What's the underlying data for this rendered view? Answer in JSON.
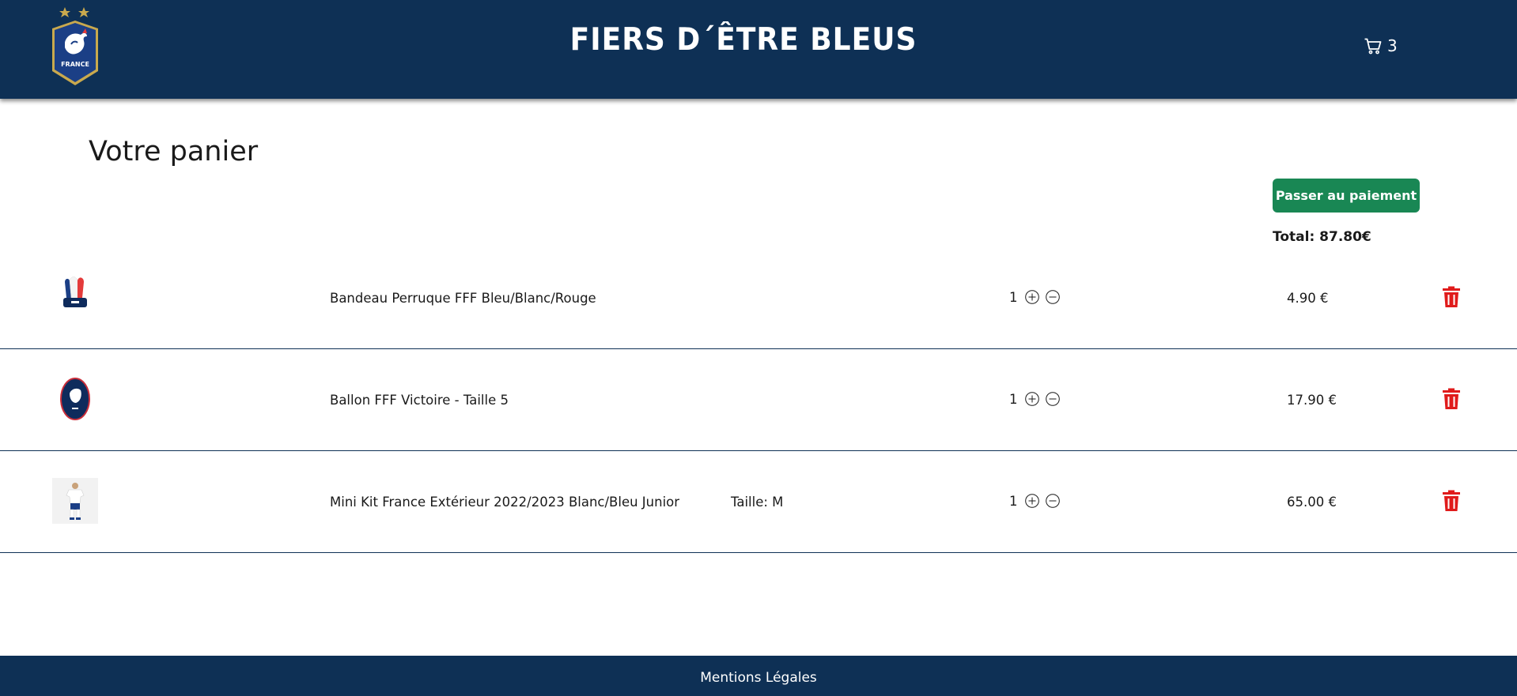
{
  "header": {
    "logo_icon": "fff-rooster-crest-icon",
    "logo_text": "FRANCE",
    "title": "FIERS D´ÊTRE BLEUS",
    "cart_icon": "shopping-cart-icon",
    "cart_count": "3"
  },
  "main": {
    "title": "Votre panier",
    "pay_button_label": "Passer au paiement",
    "total": "Total: 87.80€"
  },
  "cart": {
    "items": [
      {
        "image_icon": "headband-wig-thumbnail",
        "name": "Bandeau Perruque FFF Bleu/Blanc/Rouge",
        "size": "",
        "quantity": "1",
        "price": "4.90 €"
      },
      {
        "image_icon": "football-thumbnail",
        "name": "Ballon FFF Victoire - Taille 5",
        "size": "",
        "quantity": "1",
        "price": "17.90 €"
      },
      {
        "image_icon": "mini-kit-thumbnail",
        "name": "Mini Kit France Extérieur 2022/2023 Blanc/Bleu Junior",
        "size": "Taille: M",
        "quantity": "1",
        "price": "65.00 €"
      }
    ],
    "plus_icon": "plus-circle-icon",
    "minus_icon": "minus-circle-icon",
    "delete_icon": "trash-icon"
  },
  "footer": {
    "link_label": "Mentions Légales"
  },
  "colors": {
    "navy": "#0e3055",
    "pay_button": "#198754",
    "delete": "#e01b1b",
    "gold": "#c9a94e"
  }
}
